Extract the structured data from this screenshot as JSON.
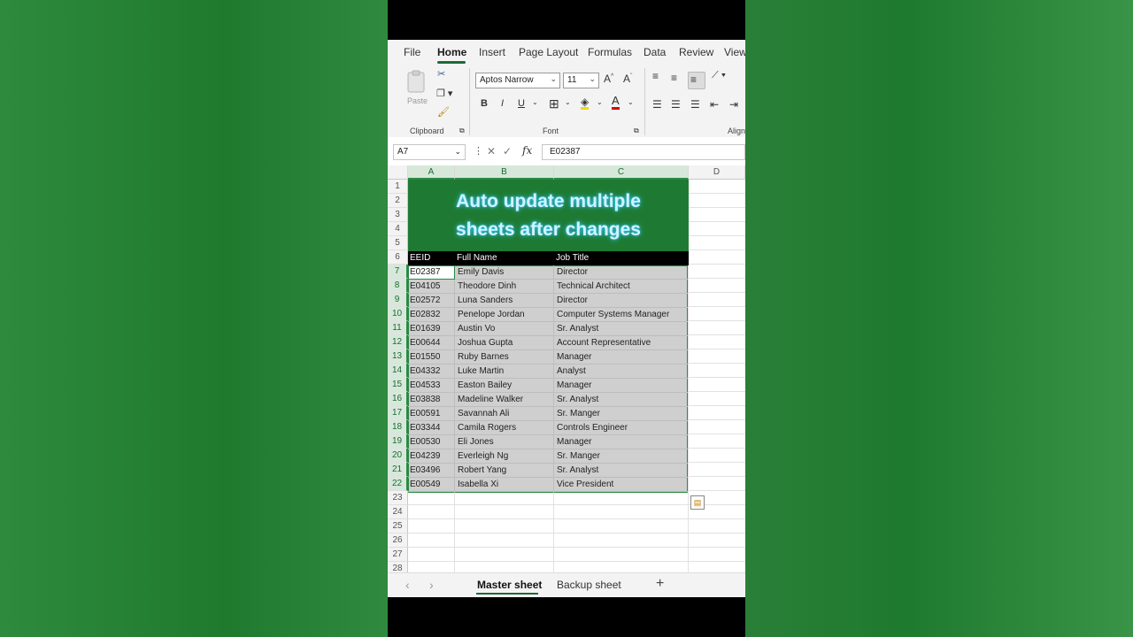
{
  "menu": {
    "tabs": [
      {
        "label": "File"
      },
      {
        "label": "Home"
      },
      {
        "label": "Insert"
      },
      {
        "label": "Page Layout"
      },
      {
        "label": "Formulas"
      },
      {
        "label": "Data"
      },
      {
        "label": "Review"
      },
      {
        "label": "View"
      }
    ],
    "active": "Home"
  },
  "ribbon": {
    "paste_label": "Paste",
    "font_name": "Aptos Narrow",
    "font_size": "11",
    "groups": {
      "clipboard": "Clipboard",
      "font": "Font",
      "alignment": "Align"
    }
  },
  "formula_bar": {
    "name_box": "A7",
    "fx": "fx",
    "content": "E02387"
  },
  "grid": {
    "columns": [
      "A",
      "B",
      "C",
      "D"
    ],
    "rows": [
      "1",
      "2",
      "3",
      "4",
      "5",
      "6",
      "7",
      "8",
      "9",
      "10",
      "11",
      "12",
      "13",
      "14",
      "15",
      "16",
      "17",
      "18",
      "19",
      "20",
      "21",
      "22",
      "23",
      "24",
      "25",
      "26",
      "27",
      "28"
    ],
    "banner_line1": "Auto update multiple",
    "banner_line2": "sheets after changes",
    "headers": [
      "EEID",
      "Full Name",
      "Job Title"
    ],
    "data": [
      [
        "E02387",
        "Emily Davis",
        "Director"
      ],
      [
        "E04105",
        "Theodore Dinh",
        "Technical Architect"
      ],
      [
        "E02572",
        "Luna Sanders",
        "Director"
      ],
      [
        "E02832",
        "Penelope Jordan",
        "Computer Systems Manager"
      ],
      [
        "E01639",
        "Austin Vo",
        "Sr. Analyst"
      ],
      [
        "E00644",
        "Joshua Gupta",
        "Account Representative"
      ],
      [
        "E01550",
        "Ruby Barnes",
        "Manager"
      ],
      [
        "E04332",
        "Luke Martin",
        "Analyst"
      ],
      [
        "E04533",
        "Easton Bailey",
        "Manager"
      ],
      [
        "E03838",
        "Madeline Walker",
        "Sr. Analyst"
      ],
      [
        "E00591",
        "Savannah Ali",
        "Sr. Manger"
      ],
      [
        "E03344",
        "Camila Rogers",
        "Controls Engineer"
      ],
      [
        "E00530",
        "Eli Jones",
        "Manager"
      ],
      [
        "E04239",
        "Everleigh Ng",
        "Sr. Manger"
      ],
      [
        "E03496",
        "Robert Yang",
        "Sr. Analyst"
      ],
      [
        "E00549",
        "Isabella Xi",
        "Vice President"
      ]
    ]
  },
  "sheets": {
    "tabs": [
      {
        "label": "Master sheet"
      },
      {
        "label": "Backup sheet"
      }
    ],
    "active": "Master sheet",
    "add": "+"
  },
  "colors": {
    "accent": "#1b6b35",
    "banner_bg": "#1e7a32",
    "banner_text": "#cff4ff",
    "selection": "#cfcfcf"
  }
}
